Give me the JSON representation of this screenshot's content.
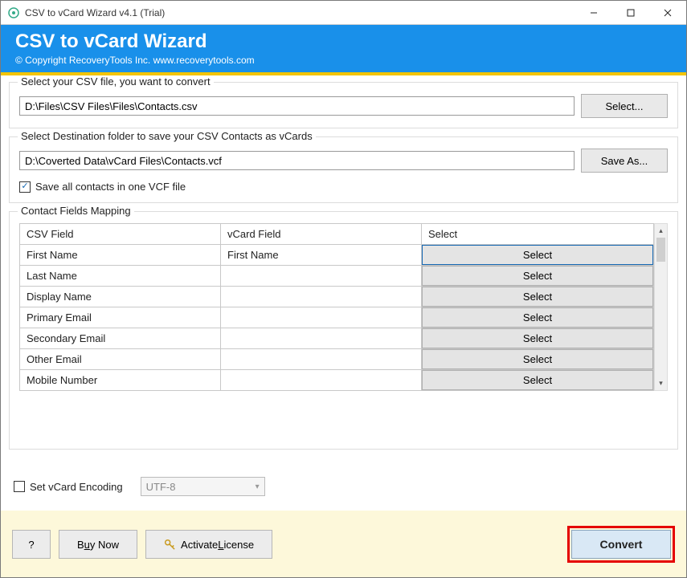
{
  "window": {
    "title": "CSV to vCard Wizard v4.1 (Trial)"
  },
  "header": {
    "title": "CSV to vCard Wizard",
    "subtitle": "© Copyright RecoveryTools Inc. www.recoverytools.com"
  },
  "source": {
    "group_label": "Select your CSV file, you want to convert",
    "path": "D:\\Files\\CSV Files\\Files\\Contacts.csv",
    "button": "Select..."
  },
  "dest": {
    "group_label": "Select Destination folder to save your CSV Contacts as vCards",
    "path": "D:\\Coverted Data\\vCard Files\\Contacts.vcf",
    "button": "Save As...",
    "save_all_label": "Save all contacts in one VCF file",
    "save_all_checked": true
  },
  "mapping": {
    "group_label": "Contact Fields Mapping",
    "headers": {
      "csv": "CSV Field",
      "vcard": "vCard Field",
      "select": "Select"
    },
    "select_button": "Select",
    "rows": [
      {
        "csv": "First Name",
        "vcard": "First Name",
        "active": true
      },
      {
        "csv": "Last Name",
        "vcard": "",
        "active": false
      },
      {
        "csv": "Display Name",
        "vcard": "",
        "active": false
      },
      {
        "csv": "Primary Email",
        "vcard": "",
        "active": false
      },
      {
        "csv": "Secondary Email",
        "vcard": "",
        "active": false
      },
      {
        "csv": "Other Email",
        "vcard": "",
        "active": false
      },
      {
        "csv": "Mobile Number",
        "vcard": "",
        "active": false
      }
    ]
  },
  "encoding": {
    "checkbox_label": "Set vCard Encoding",
    "checked": false,
    "value": "UTF-8"
  },
  "footer": {
    "help": "?",
    "buy_pre": "B",
    "buy_u": "u",
    "buy_post": "y Now",
    "activate_pre": "Activate ",
    "activate_u": "L",
    "activate_post": "icense",
    "convert": "Convert"
  }
}
